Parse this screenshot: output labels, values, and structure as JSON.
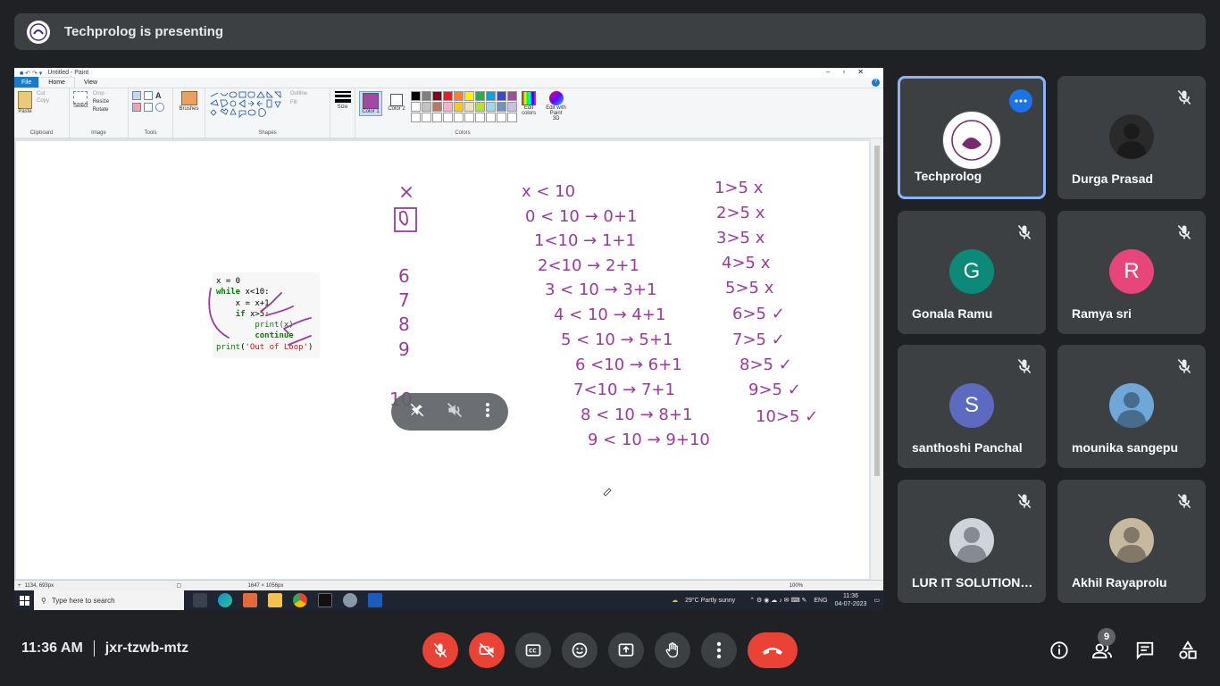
{
  "banner": {
    "title": "Techprolog is presenting"
  },
  "paint": {
    "window_title": "Untitled - Paint",
    "menu": {
      "file": "File",
      "home": "Home",
      "view": "View"
    },
    "ribbon": {
      "paste": "Paste",
      "cut": "Cut",
      "copy": "Copy",
      "clipboard": "Clipboard",
      "select": "Select",
      "crop": "Crop",
      "resize": "Resize",
      "rotate": "Rotate",
      "image": "Image",
      "tools": "Tools",
      "brushes": "Brushes",
      "outline": "Outline",
      "fill": "Fill",
      "shapes": "Shapes",
      "size": "Size",
      "color1": "Color 1",
      "color2": "Color 2",
      "colors": "Colors",
      "edit_colors": "Edit colors",
      "edit_paint3d": "Edit with Paint 3D"
    },
    "palette": [
      "#000000",
      "#7f7f7f",
      "#880015",
      "#ed1c24",
      "#ff7f27",
      "#fff200",
      "#22b14c",
      "#00a2e8",
      "#3f48cc",
      "#a349a4",
      "#ffffff",
      "#c3c3c3",
      "#b97a57",
      "#ffaec9",
      "#ffc90e",
      "#efe4b0",
      "#b5e61d",
      "#99d9ea",
      "#7092be",
      "#c8bfe7",
      "#ffffff",
      "#ffffff",
      "#ffffff",
      "#ffffff",
      "#ffffff",
      "#ffffff",
      "#ffffff",
      "#ffffff",
      "#ffffff",
      "#ffffff"
    ],
    "status": {
      "cursor": "1134, 693px",
      "size": "1647 × 1056px",
      "zoom": "100%"
    },
    "code_lines": [
      "x = 0",
      "while x<10:",
      "    x = x+1",
      "    if x>5:",
      "        print(x)",
      "        continue",
      "print('Out of Loop')"
    ]
  },
  "taskbar": {
    "search": "Type here to search",
    "weather": "29°C  Partly sunny",
    "lang": "ENG",
    "time": "11:36",
    "date": "04-07-2023"
  },
  "participants": [
    {
      "name": "Techprolog",
      "initial": "",
      "color": "#ffffff"
    },
    {
      "name": "Durga Prasad",
      "initial": "",
      "color": "#2a2a2a"
    },
    {
      "name": "Gonala Ramu",
      "initial": "G",
      "color": "#0b8a7a"
    },
    {
      "name": "Ramya sri",
      "initial": "R",
      "color": "#e8457a"
    },
    {
      "name": "santhoshi Panchal",
      "initial": "S",
      "color": "#5c6bc0"
    },
    {
      "name": "mounika sangepu",
      "initial": "",
      "color": "#6fa8d8"
    },
    {
      "name": "LUR IT SOLUTIONS...",
      "initial": "",
      "color": "#cfd4da"
    },
    {
      "name": "Akhil Rayaprolu",
      "initial": "",
      "color": "#c7b9a0"
    }
  ],
  "meeting": {
    "time": "11:36 AM",
    "code": "jxr-tzwb-mtz",
    "participant_count": "9"
  },
  "colors": {
    "accent": "#8ab4f8",
    "red": "#ea4335",
    "ink": "#9b3a9b"
  }
}
